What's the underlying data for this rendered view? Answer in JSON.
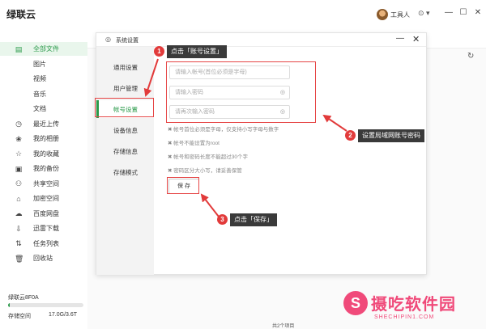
{
  "app": {
    "title": "绿联云",
    "user_name": "工具人",
    "settings_glyph": "⊙ ▾"
  },
  "window_controls": [
    "—",
    "☐",
    "✕"
  ],
  "sidebar": {
    "items": [
      {
        "label": "全部文件",
        "icon": "file-icon",
        "glyph": "▤",
        "active": true,
        "sub": false
      },
      {
        "label": "图片",
        "icon": "",
        "glyph": "",
        "active": false,
        "sub": true
      },
      {
        "label": "视频",
        "icon": "",
        "glyph": "",
        "active": false,
        "sub": true
      },
      {
        "label": "音乐",
        "icon": "",
        "glyph": "",
        "active": false,
        "sub": true
      },
      {
        "label": "文档",
        "icon": "",
        "glyph": "",
        "active": false,
        "sub": true
      },
      {
        "label": "最近上传",
        "icon": "clock-icon",
        "glyph": "◷",
        "active": false,
        "sub": false
      },
      {
        "label": "我的相册",
        "icon": "album-icon",
        "glyph": "❀",
        "active": false,
        "sub": false
      },
      {
        "label": "我的收藏",
        "icon": "star-icon",
        "glyph": "☆",
        "active": false,
        "sub": false
      },
      {
        "label": "我的备份",
        "icon": "backup-icon",
        "glyph": "▣",
        "active": false,
        "sub": false
      },
      {
        "label": "共享空间",
        "icon": "share-icon",
        "glyph": "⚇",
        "active": false,
        "sub": false
      },
      {
        "label": "加密空间",
        "icon": "lock-icon",
        "glyph": "⌂",
        "active": false,
        "sub": false
      },
      {
        "label": "百度网盘",
        "icon": "cloud-icon",
        "glyph": "☁",
        "active": false,
        "sub": false
      },
      {
        "label": "迅雷下载",
        "icon": "download-icon",
        "glyph": "⇩",
        "active": false,
        "sub": false
      },
      {
        "label": "任务列表",
        "icon": "transfer-icon",
        "glyph": "⇅",
        "active": false,
        "sub": false
      },
      {
        "label": "回收站",
        "icon": "trash-icon",
        "glyph": "🗑",
        "active": false,
        "sub": false
      }
    ],
    "device": "绿联云8F0A",
    "storage_label": "存储空间",
    "storage_value": "17.0G/3.6T",
    "storage_fraction": 0.005
  },
  "main": {
    "footer_count": "共2个项目",
    "refresh_glyph": "↻"
  },
  "dialog": {
    "title": "系统设置",
    "gear_glyph": "◎",
    "min_glyph": "—",
    "close_glyph": "✕",
    "nav": [
      {
        "label": "通用设置",
        "active": false
      },
      {
        "label": "用户管理",
        "active": false
      },
      {
        "label": "帐号设置",
        "active": true
      },
      {
        "label": "设备信息",
        "active": false
      },
      {
        "label": "存储信息",
        "active": false
      },
      {
        "label": "存储模式",
        "active": false
      }
    ],
    "fields": {
      "account_placeholder": "请输入帐号(首位必须是字母)",
      "password_placeholder": "请输入密码",
      "confirm_placeholder": "请再次输入密码",
      "eye_glyph": "◎"
    },
    "rules": [
      "✖ 帐号首位必须是字母，仅支持小写字母与数字",
      "✖ 帐号不能设置为root",
      "✖ 帐号和密码长度不能超过30个字",
      "✖ 密码区分大小写，请妥善保管"
    ],
    "save_label": "保 存"
  },
  "annotations": {
    "step1": {
      "num": "1",
      "text": "点击「账号设置」"
    },
    "step2": {
      "num": "2",
      "text": "设置局域网账号密码"
    },
    "step3": {
      "num": "3",
      "text": "点击「保存」"
    },
    "color": "#e23b3b"
  },
  "watermark": {
    "logo": "S",
    "text": "摄吃软件园",
    "url": "SHECHIPIN1.COM"
  }
}
